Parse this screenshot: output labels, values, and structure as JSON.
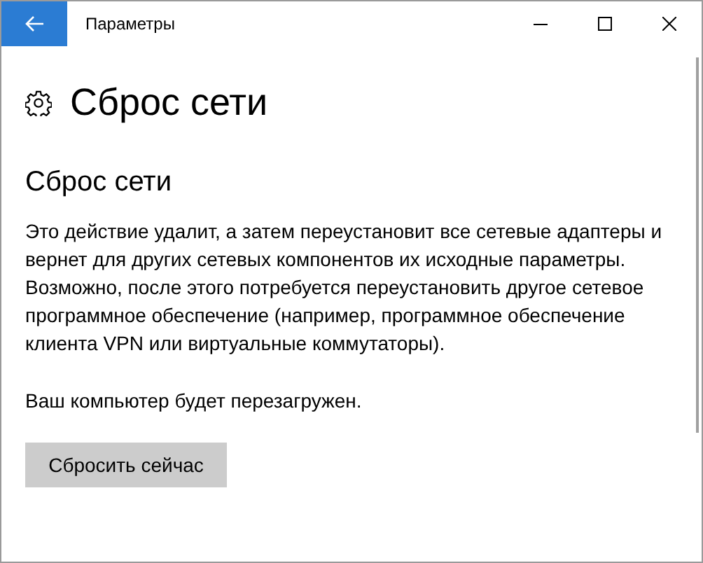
{
  "window": {
    "title": "Параметры"
  },
  "page_title": "Сброс сети",
  "section": {
    "title": "Сброс сети",
    "paragraphs": [
      "Это действие удалит, а затем переустановит все сетевые адаптеры и вернет для других сетевых компонентов их исходные параметры. Возможно, после этого потребуется переустановить другое сетевое программное обеспечение (например, программное обеспечение клиента VPN или виртуальные коммутаторы).",
      "Ваш компьютер будет перезагружен."
    ]
  },
  "button": {
    "label": "Сбросить сейчас"
  }
}
